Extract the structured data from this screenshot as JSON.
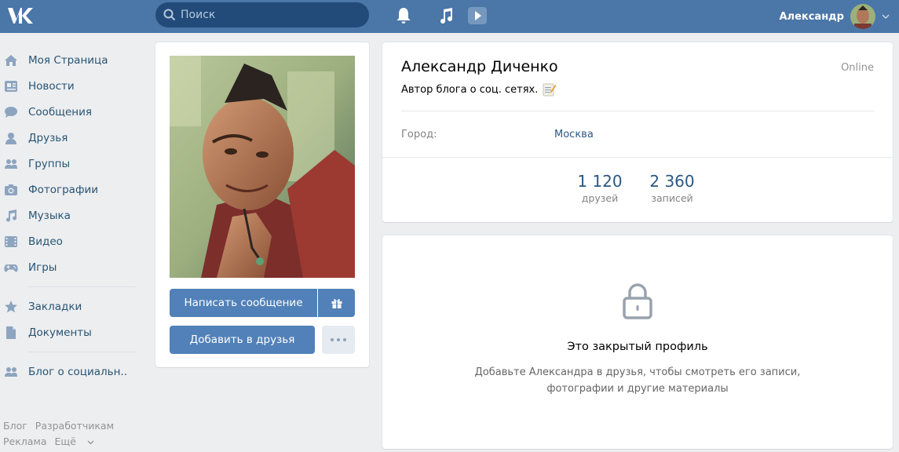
{
  "header": {
    "search_placeholder": "Поиск",
    "user_name": "Александр"
  },
  "sidebar": {
    "items": [
      {
        "label": "Моя Страница",
        "icon": "home-icon"
      },
      {
        "label": "Новости",
        "icon": "news-icon"
      },
      {
        "label": "Сообщения",
        "icon": "messages-icon"
      },
      {
        "label": "Друзья",
        "icon": "friends-icon"
      },
      {
        "label": "Группы",
        "icon": "groups-icon"
      },
      {
        "label": "Фотографии",
        "icon": "camera-icon"
      },
      {
        "label": "Музыка",
        "icon": "music-icon"
      },
      {
        "label": "Видео",
        "icon": "video-icon"
      },
      {
        "label": "Игры",
        "icon": "gamepad-icon"
      }
    ],
    "items2": [
      {
        "label": "Закладки",
        "icon": "star-icon"
      },
      {
        "label": "Документы",
        "icon": "document-icon"
      }
    ],
    "items3": [
      {
        "label": "Блог о социальн..",
        "icon": "groups-icon"
      }
    ],
    "footer": {
      "blog": "Блог",
      "developers": "Разработчикам",
      "ads": "Реклама",
      "more": "Ещё"
    }
  },
  "profile": {
    "send_message": "Написать сообщение",
    "add_friend": "Добавить в друзья",
    "name": "Александр Диченко",
    "status": "Автор блога о соц. сетях.",
    "online": "Online",
    "city_label": "Город:",
    "city_value": "Москва",
    "counters": [
      {
        "value": "1 120",
        "label": "друзей"
      },
      {
        "value": "2 360",
        "label": "записей"
      }
    ]
  },
  "closed": {
    "title": "Это закрытый профиль",
    "description": "Добавьте Александра в друзья, чтобы смотреть его записи, фотографии и другие материалы"
  },
  "colors": {
    "header_bg": "#4a76a8",
    "button": "#5181b8",
    "link": "#2a5885",
    "background": "#edeef0"
  }
}
